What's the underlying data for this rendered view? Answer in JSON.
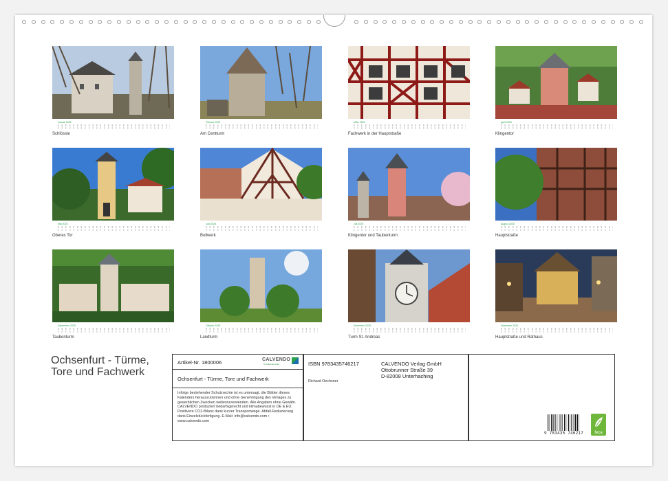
{
  "calendar": {
    "title": "Ochsenfurt - Türme, Tore und Fachwerk",
    "months": [
      {
        "month": "Januar 2025",
        "caption": "Schlössle",
        "icon": "castle-photo"
      },
      {
        "month": "Februar 2025",
        "caption": "Am Centturm",
        "icon": "tower-photo"
      },
      {
        "month": "März 2025",
        "caption": "Fachwerk in der Hauptstraße",
        "icon": "half-timbered-photo"
      },
      {
        "month": "April 2025",
        "caption": "Klingentor",
        "icon": "gate-tower-photo"
      },
      {
        "month": "Mai 2025",
        "caption": "Oberes Tor",
        "icon": "gate-tower-photo"
      },
      {
        "month": "Juni 2025",
        "caption": "Bollwerk",
        "icon": "half-timbered-photo"
      },
      {
        "month": "Juli 2025",
        "caption": "Klingentor und Taubenturm",
        "icon": "towers-photo"
      },
      {
        "month": "August 2025",
        "caption": "Hauptstraße",
        "icon": "street-photo"
      },
      {
        "month": "September 2025",
        "caption": "Taubenturm",
        "icon": "tower-photo"
      },
      {
        "month": "Oktober 2025",
        "caption": "Landturm",
        "icon": "tower-photo"
      },
      {
        "month": "November 2025",
        "caption": "Turm St. Andreas",
        "icon": "clock-tower-photo"
      },
      {
        "month": "Dezember 2025",
        "caption": "Hauptstraße und Rathaus",
        "icon": "night-street-photo"
      }
    ]
  },
  "info": {
    "article": "Artikel-Nr. 1800006",
    "product_title": "Ochsenfurt - Türme, Tore und Fachwerk",
    "legal": "Infolge bestehender Schutzrechte ist es untersagt, die Blätter dieses Kalenders herauszutrennen und ohne Genehmigung des Verlages zu gewerblichen Zwecken weiterzuverwenden. Alle Angaben ohne Gewähr. CALVENDO produziert bedarfsgerecht und klimabewusst in DE & EU. Positivere CO2-Bilanz dank kurzer Transportwege. Abfall-Reduzierung dank Einzelstückfertigung. E-Mail: info@calvendo.com • www.calvendo.com",
    "isbn": "ISBN 9783435746217",
    "author": "Richard Oechsner",
    "publisher_name": "CALVENDO Verlag GmbH",
    "publisher_street": "Ottobrunner Straße 39",
    "publisher_city": "D-82008 Unterhaching",
    "logo_text": "CALVENDO",
    "logo_sub": "Ihr Kalenderverlag",
    "barcode_number": "9 783435 746217",
    "feca_label": "feca",
    "accent_color": "#2aa14a"
  }
}
